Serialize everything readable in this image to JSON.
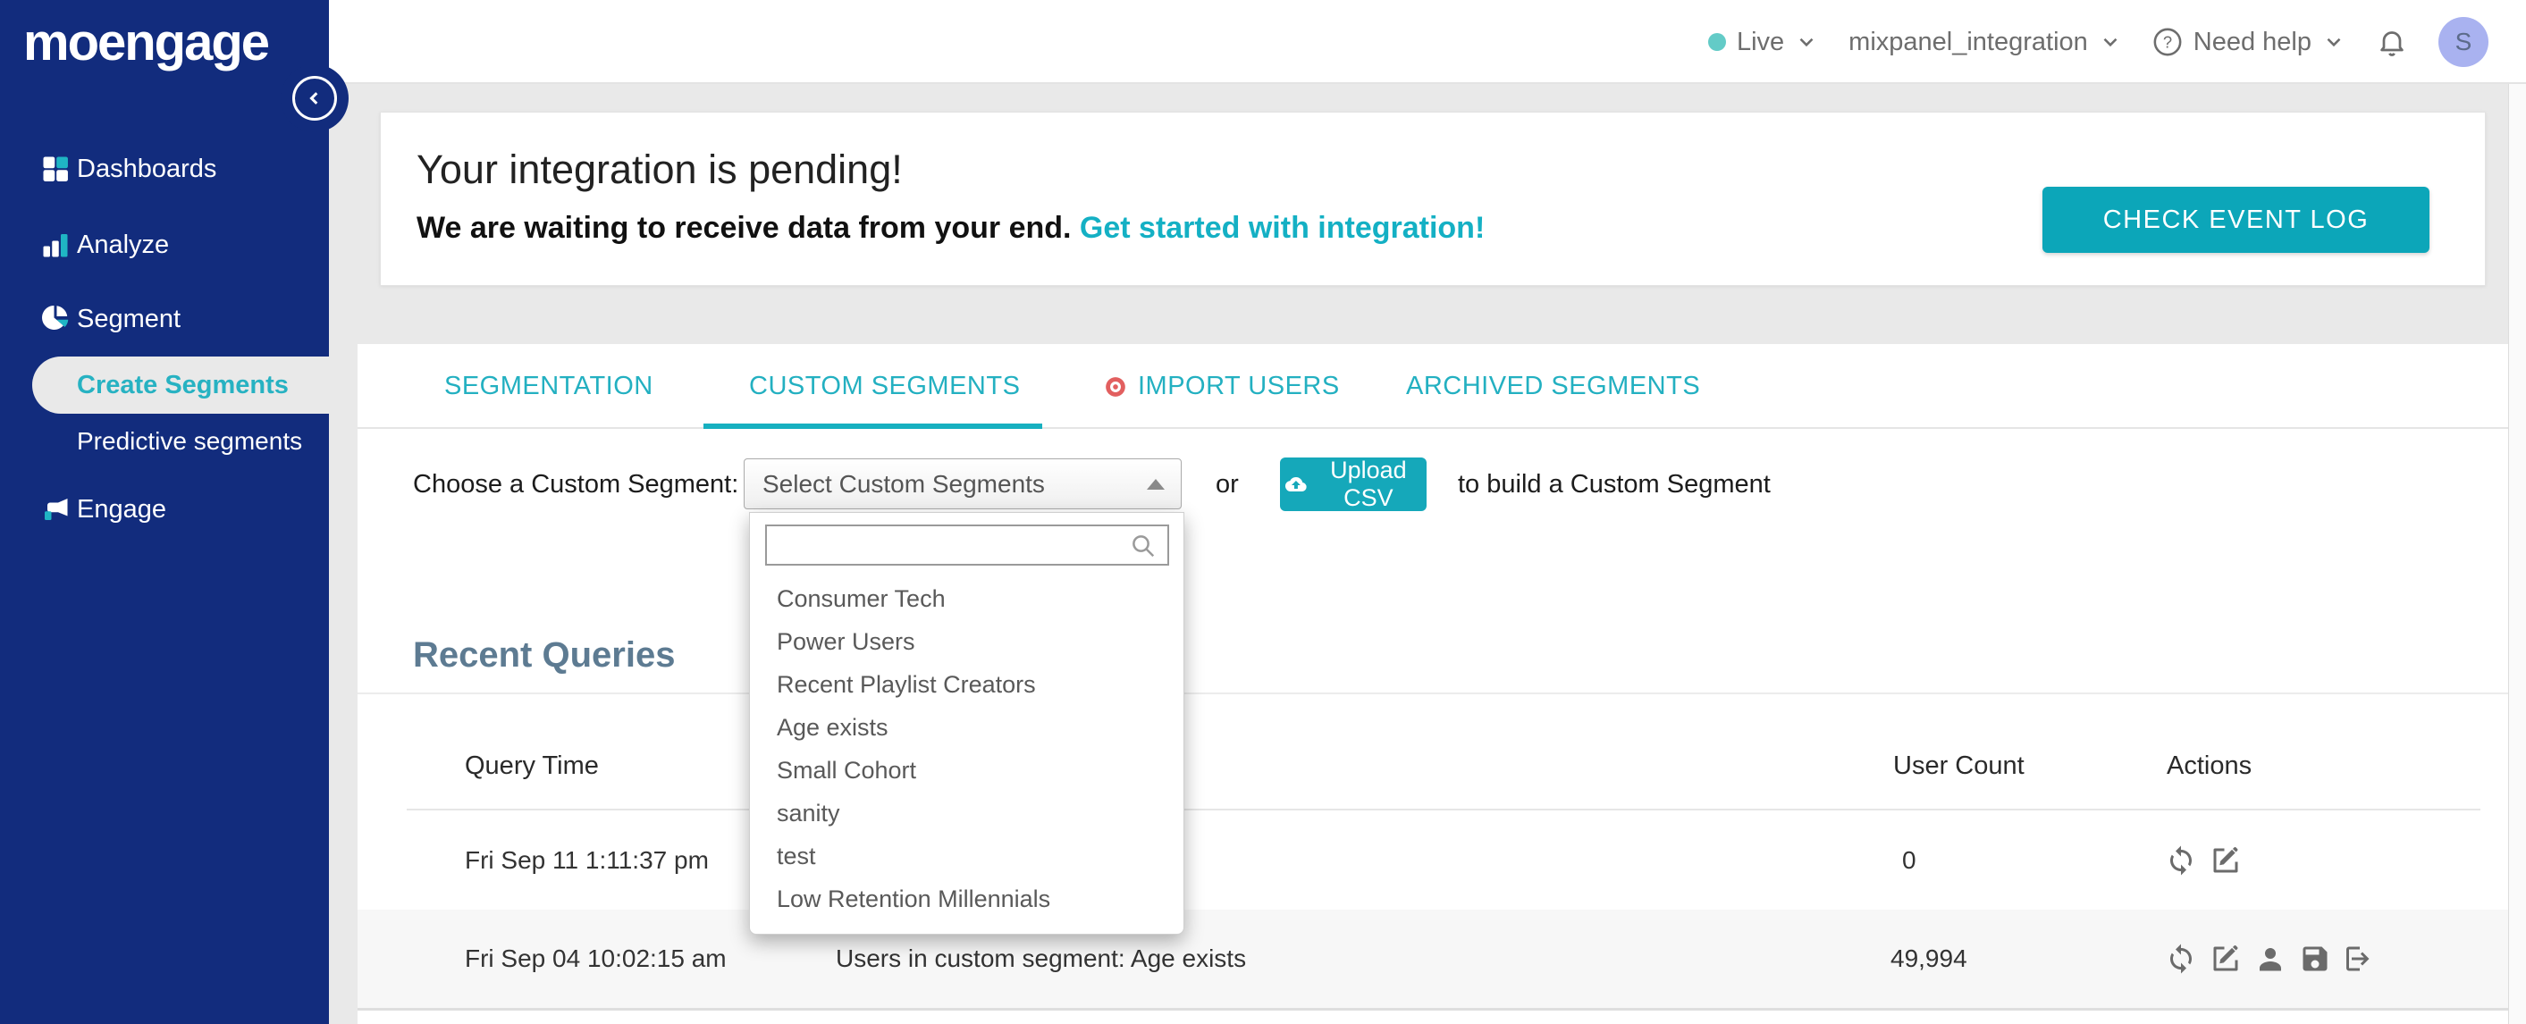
{
  "brand": {
    "logo": "moengage"
  },
  "topbar": {
    "live_label": "Live",
    "project_name": "mixpanel_integration",
    "help_label": "Need help",
    "avatar_initial": "S"
  },
  "sidebar": {
    "items": [
      {
        "label": "Dashboards"
      },
      {
        "label": "Analyze"
      },
      {
        "label": "Segment"
      },
      {
        "label": "Create Segments",
        "active": true
      },
      {
        "label": "Predictive segments"
      },
      {
        "label": "Engage"
      }
    ]
  },
  "banner": {
    "title": "Your integration is pending!",
    "subtitle": "We are waiting to receive data from your end.",
    "link_text": "Get started with integration!",
    "button_label": "CHECK EVENT LOG"
  },
  "tabs": {
    "items": [
      {
        "label": "SEGMENTATION",
        "active": false
      },
      {
        "label": "CUSTOM SEGMENTS",
        "active": true
      },
      {
        "label": "IMPORT USERS",
        "active": false,
        "dot": true
      },
      {
        "label": "ARCHIVED SEGMENTS",
        "active": false
      }
    ]
  },
  "chooser": {
    "label": "Choose a Custom Segment:",
    "select_value": "Select Custom Segments",
    "or_text": "or",
    "upload_label": "Upload CSV",
    "suffix": "to build a Custom Segment",
    "search_value": ""
  },
  "dropdown": {
    "options": [
      "Consumer Tech",
      "Power Users",
      "Recent Playlist Creators",
      "Age exists",
      "Small Cohort",
      "sanity",
      "test",
      "Low Retention Millennials"
    ]
  },
  "recent": {
    "title": "Recent Queries",
    "columns": [
      "Query Time",
      "User Count",
      "Actions"
    ],
    "rows": [
      {
        "time": "Fri Sep 11 1:11:37 pm",
        "query": "",
        "user_count": "0"
      },
      {
        "time": "Fri Sep 04 10:02:15 am",
        "query": "Users in custom segment: Age exists",
        "user_count": "49,994"
      }
    ]
  },
  "colors": {
    "sidebar_navy": "#122c7d",
    "accent_teal": "#11aabd",
    "active_item_teal": "#27b2c2",
    "live_dot_teal": "#63cbc7",
    "avatar_purple": "#a9b2f0",
    "import_dot_red": "#e25f5f",
    "heading_slate": "#5d7b92",
    "page_bg": "#e9e9e9"
  }
}
